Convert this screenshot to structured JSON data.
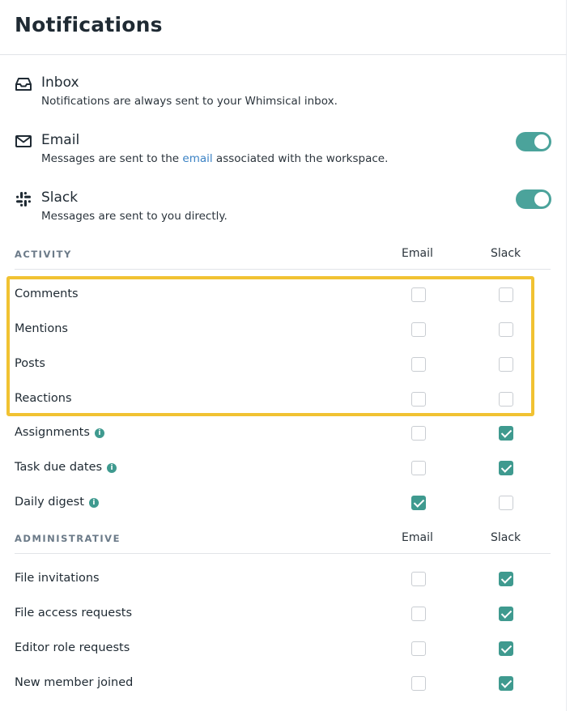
{
  "header": {
    "title": "Notifications"
  },
  "channels": [
    {
      "icon": "inbox-icon",
      "name": "Inbox",
      "desc_before": "Notifications are always sent to your Whimsical inbox.",
      "desc_link": "",
      "desc_after": "",
      "toggle_on": null
    },
    {
      "icon": "envelope-icon",
      "name": "Email",
      "desc_before": "Messages are sent to the ",
      "desc_link": "email",
      "desc_after": " associated with the workspace.",
      "toggle_on": true
    },
    {
      "icon": "slack-icon",
      "name": "Slack",
      "desc_before": "Messages are sent to you directly.",
      "desc_link": "",
      "desc_after": "",
      "toggle_on": true
    }
  ],
  "sections": [
    {
      "label": "ACTIVITY",
      "col_email": "Email",
      "col_slack": "Slack",
      "rows": [
        {
          "label": "Comments",
          "info": false,
          "email": false,
          "slack": false
        },
        {
          "label": "Mentions",
          "info": false,
          "email": false,
          "slack": false
        },
        {
          "label": "Posts",
          "info": false,
          "email": false,
          "slack": false
        },
        {
          "label": "Reactions",
          "info": false,
          "email": false,
          "slack": false
        },
        {
          "label": "Assignments",
          "info": true,
          "email": false,
          "slack": true
        },
        {
          "label": "Task due dates",
          "info": true,
          "email": false,
          "slack": true
        },
        {
          "label": "Daily digest",
          "info": true,
          "email": true,
          "slack": false
        }
      ]
    },
    {
      "label": "ADMINISTRATIVE",
      "col_email": "Email",
      "col_slack": "Slack",
      "rows": [
        {
          "label": "File invitations",
          "info": false,
          "email": false,
          "slack": true
        },
        {
          "label": "File access requests",
          "info": false,
          "email": false,
          "slack": true
        },
        {
          "label": "Editor role requests",
          "info": false,
          "email": false,
          "slack": true
        },
        {
          "label": "New member joined",
          "info": false,
          "email": false,
          "slack": true
        }
      ]
    }
  ],
  "info_glyph": "i",
  "colors": {
    "accent": "#3f9a8f",
    "toggle": "#4ba39b",
    "highlight": "#f1c232",
    "link": "#3b82c4"
  }
}
